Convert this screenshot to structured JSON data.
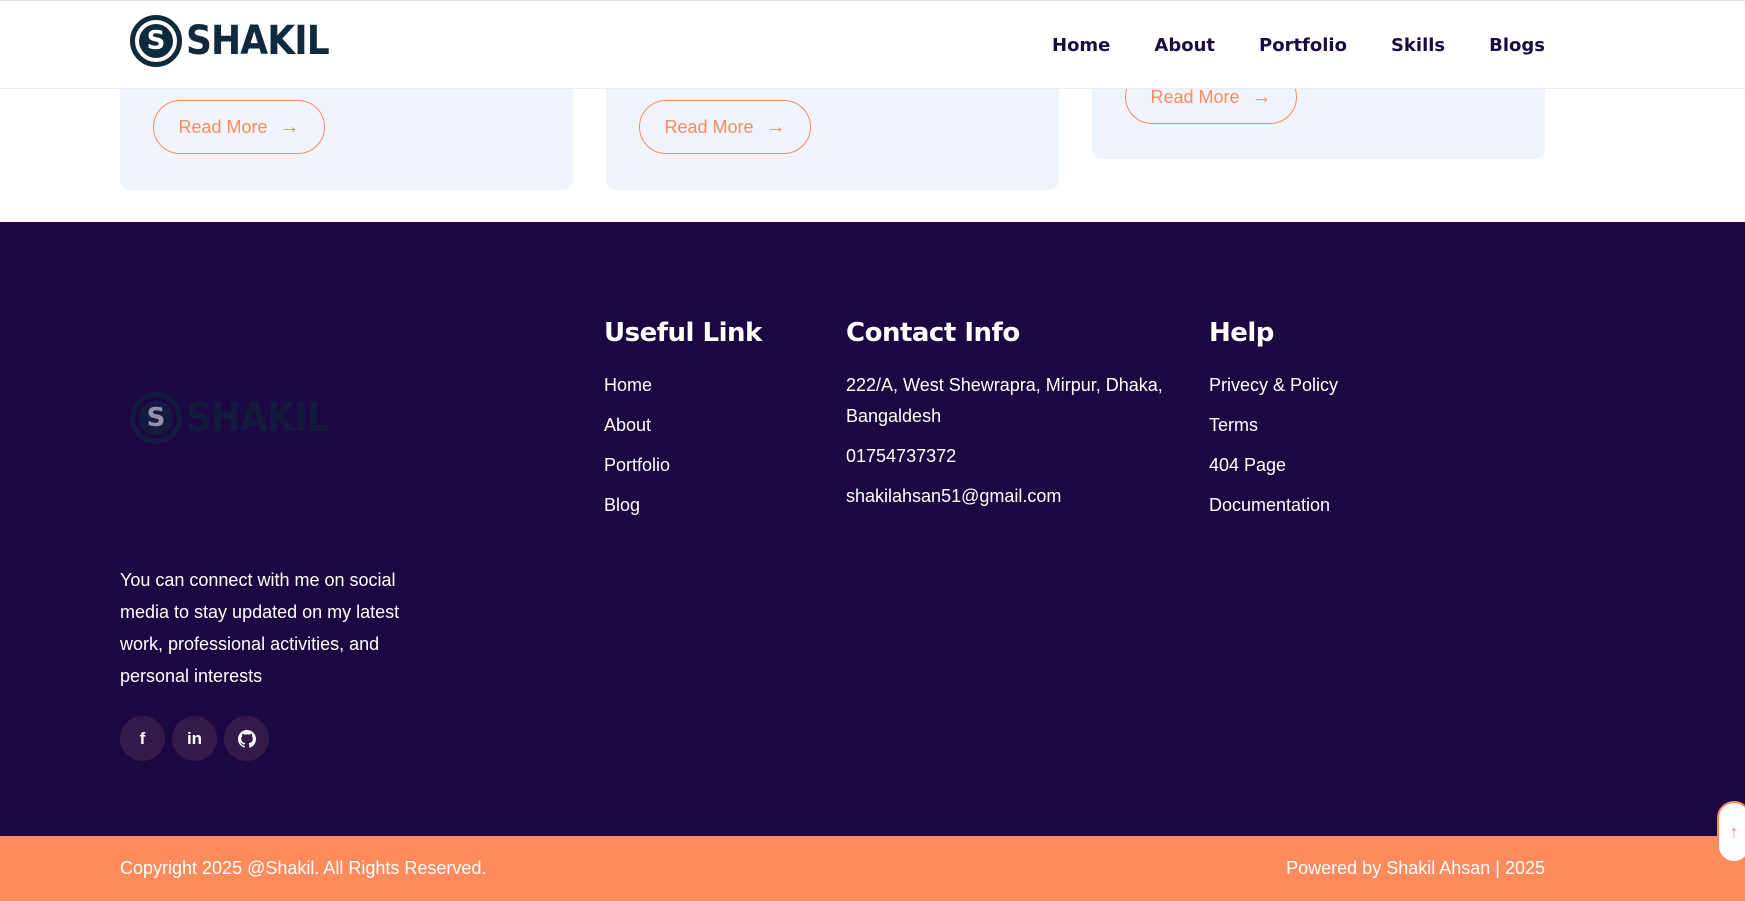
{
  "header": {
    "logo_letter": "S",
    "logo_text": "SHAKIL",
    "nav": [
      {
        "label": "Home"
      },
      {
        "label": "About"
      },
      {
        "label": "Portfolio"
      },
      {
        "label": "Skills"
      },
      {
        "label": "Blogs"
      }
    ]
  },
  "cards": {
    "read_more_label": "Read More",
    "arrow_icon": "arrow-right-icon"
  },
  "footer": {
    "logo_letter": "S",
    "logo_text": "SHAKIL",
    "about_text": "You can connect with me on social media to stay updated on my latest work, professional activities, and personal interests",
    "socials": [
      {
        "icon": "facebook-icon",
        "glyph": "f"
      },
      {
        "icon": "linkedin-icon",
        "glyph": "in"
      },
      {
        "icon": "github-icon",
        "glyph": "⌾"
      }
    ],
    "useful_links": {
      "title": "Useful Link",
      "items": [
        "Home",
        "About",
        "Portfolio",
        "Blog"
      ]
    },
    "contact": {
      "title": "Contact Info",
      "address": "222/A, West Shewrapra, Mirpur, Dhaka, Bangaldesh",
      "phone": "01754737372",
      "email": "shakilahsan51@gmail.com"
    },
    "help": {
      "title": "Help",
      "items": [
        "Privecy & Policy",
        "Terms",
        "404 Page",
        "Documentation"
      ]
    }
  },
  "bottom_bar": {
    "copyright": "Copyright 2025 @Shakil. All Rights Reserved.",
    "powered": "Powered by Shakil Ahsan | 2025"
  },
  "scroll_top": {
    "glyph": "↑"
  },
  "colors": {
    "navy": "#1b0742",
    "accent": "#ff8a5c",
    "card_bg": "#f0f5fd"
  }
}
